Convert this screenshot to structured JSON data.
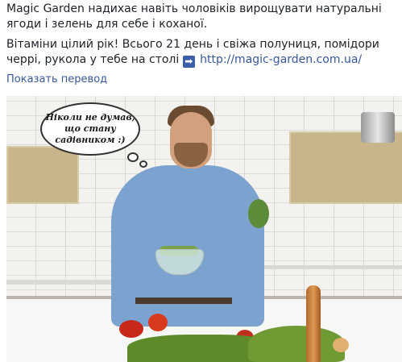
{
  "post": {
    "paragraph1": "Magic Garden надихає навіть чоловіків вирощувати натуральні ягоди і зелень для себе і коханої.",
    "paragraph2_text": "Вітаміни цілий рік! Всього 21 день і свіжа полуниця, помідори черрі, рукола у тебе на столі",
    "arrow_icon": "right-arrow-emoji-icon",
    "link_text": "http://magic-garden.com.ua/",
    "see_translation": "Показать перевод"
  },
  "image": {
    "bubble_text": "Ніколи не думав, що стану садівником :)"
  },
  "colors": {
    "link": "#385898",
    "text": "#1d2129"
  }
}
